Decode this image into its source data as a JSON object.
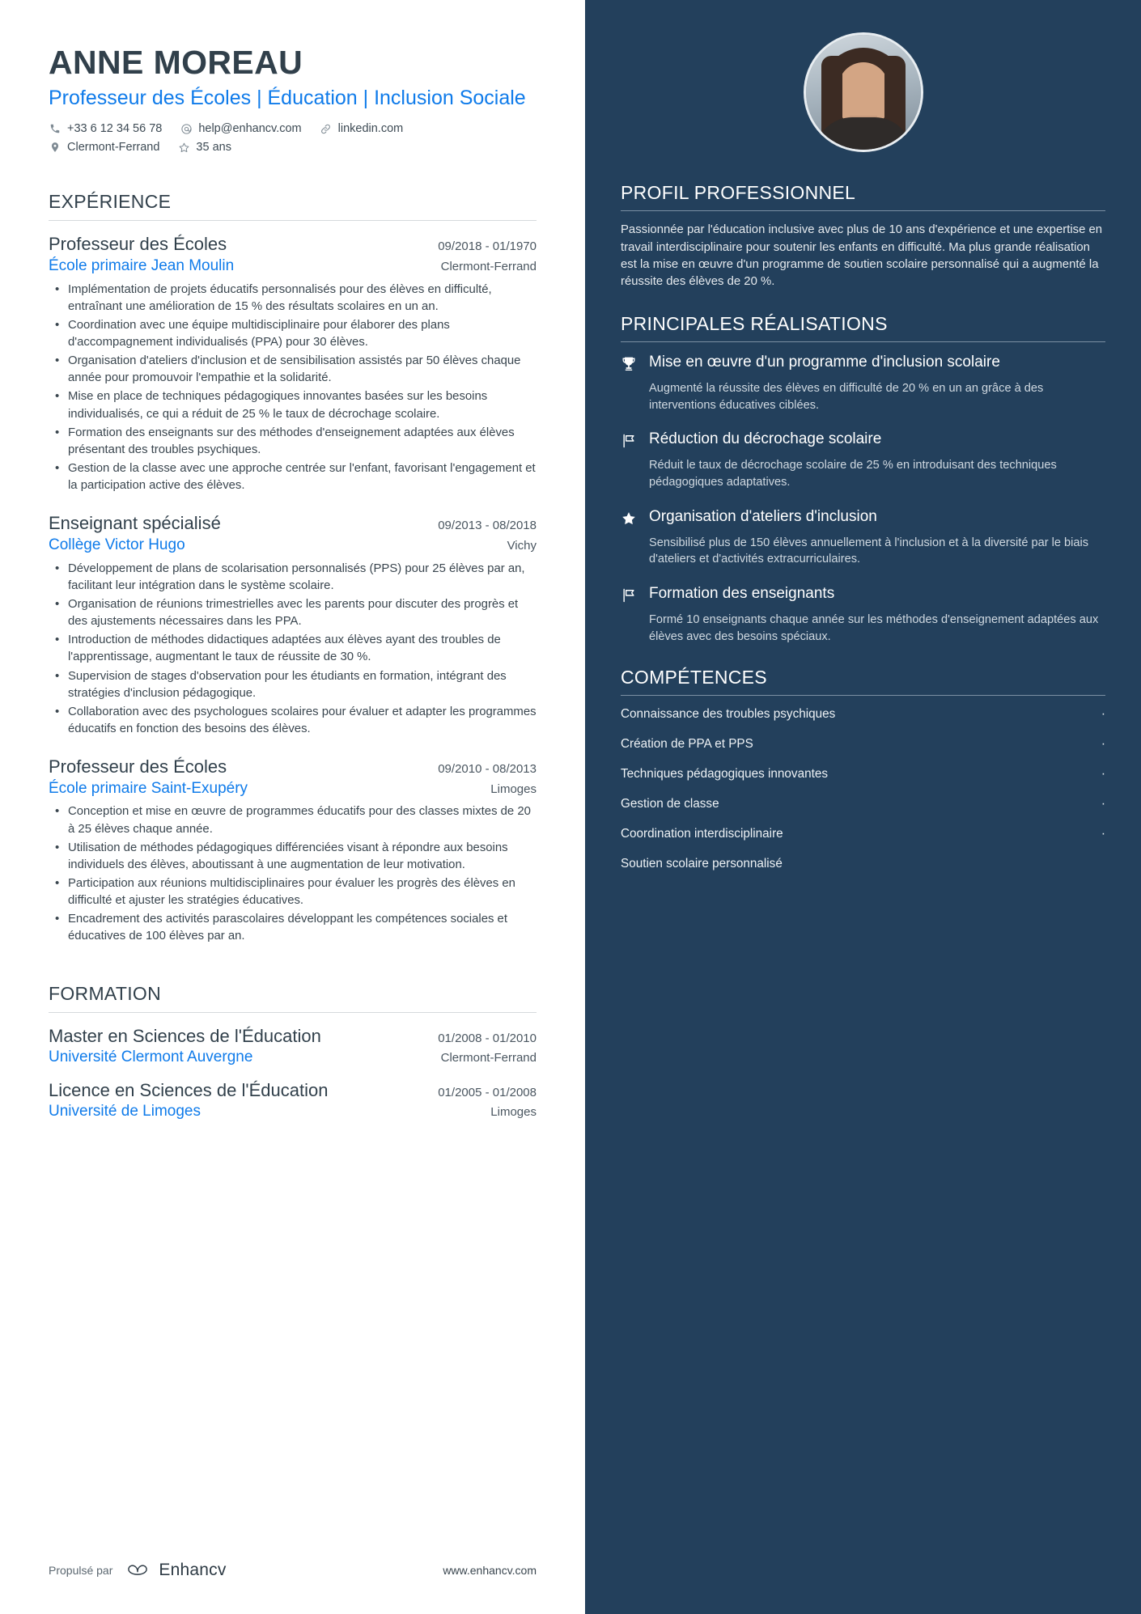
{
  "header": {
    "name": "ANNE MOREAU",
    "headline": "Professeur des Écoles | Éducation | Inclusion Sociale",
    "contact": {
      "phone": "+33 6 12 34 56 78",
      "email": "help@enhancv.com",
      "link": "linkedin.com",
      "location": "Clermont-Ferrand",
      "age": "35 ans"
    }
  },
  "sections": {
    "experience_title": "EXPÉRIENCE",
    "education_title": "FORMATION"
  },
  "experience": [
    {
      "title": "Professeur des Écoles",
      "date": "09/2018 - 01/1970",
      "org": "École primaire Jean Moulin",
      "location": "Clermont-Ferrand",
      "bullets": [
        "Implémentation de projets éducatifs personnalisés pour des élèves en difficulté, entraînant une amélioration de 15 % des résultats scolaires en un an.",
        "Coordination avec une équipe multidisciplinaire pour élaborer des plans d'accompagnement individualisés (PPA) pour 30 élèves.",
        "Organisation d'ateliers d'inclusion et de sensibilisation assistés par 50 élèves chaque année pour promouvoir l'empathie et la solidarité.",
        "Mise en place de techniques pédagogiques innovantes basées sur les besoins individualisés, ce qui a réduit de 25 % le taux de décrochage scolaire.",
        "Formation des enseignants sur des méthodes d'enseignement adaptées aux élèves présentant des troubles psychiques.",
        "Gestion de la classe avec une approche centrée sur l'enfant, favorisant l'engagement et la participation active des élèves."
      ]
    },
    {
      "title": "Enseignant spécialisé",
      "date": "09/2013 - 08/2018",
      "org": "Collège Victor Hugo",
      "location": "Vichy",
      "bullets": [
        "Développement de plans de scolarisation personnalisés (PPS) pour 25 élèves par an, facilitant leur intégration dans le système scolaire.",
        "Organisation de réunions trimestrielles avec les parents pour discuter des progrès et des ajustements nécessaires dans les PPA.",
        "Introduction de méthodes didactiques adaptées aux élèves ayant des troubles de l'apprentissage, augmentant le taux de réussite de 30 %.",
        "Supervision de stages d'observation pour les étudiants en formation, intégrant des stratégies d'inclusion pédagogique.",
        "Collaboration avec des psychologues scolaires pour évaluer et adapter les programmes éducatifs en fonction des besoins des élèves."
      ]
    },
    {
      "title": "Professeur des Écoles",
      "date": "09/2010 - 08/2013",
      "org": "École primaire Saint-Exupéry",
      "location": "Limoges",
      "bullets": [
        "Conception et mise en œuvre de programmes éducatifs pour des classes mixtes de 20 à 25 élèves chaque année.",
        "Utilisation de méthodes pédagogiques différenciées visant à répondre aux besoins individuels des élèves, aboutissant à une augmentation de leur motivation.",
        "Participation aux réunions multidisciplinaires pour évaluer les progrès des élèves en difficulté et ajuster les stratégies éducatives.",
        "Encadrement des activités parascolaires développant les compétences sociales et éducatives de 100 élèves par an."
      ]
    }
  ],
  "education": [
    {
      "title": "Master en Sciences de l'Éducation",
      "date": "01/2008 - 01/2010",
      "org": "Université Clermont Auvergne",
      "location": "Clermont-Ferrand"
    },
    {
      "title": "Licence en Sciences de l'Éducation",
      "date": "01/2005 - 01/2008",
      "org": "Université de Limoges",
      "location": "Limoges"
    }
  ],
  "sidebar": {
    "profile_title": "PROFIL PROFESSIONNEL",
    "profile_text": "Passionnée par l'éducation inclusive avec plus de 10 ans d'expérience et une expertise en travail interdisciplinaire pour soutenir les enfants en difficulté. Ma plus grande réalisation est la mise en œuvre d'un programme de soutien scolaire personnalisé qui a augmenté la réussite des élèves de 20 %.",
    "achievements_title": "PRINCIPALES RÉALISATIONS",
    "achievements": [
      {
        "icon": "trophy-icon",
        "title": "Mise en œuvre d'un programme d'inclusion scolaire",
        "desc": "Augmenté la réussite des élèves en difficulté de 20 % en un an grâce à des interventions éducatives ciblées."
      },
      {
        "icon": "flag-icon",
        "title": "Réduction du décrochage scolaire",
        "desc": "Réduit le taux de décrochage scolaire de 25 % en introduisant des techniques pédagogiques adaptatives."
      },
      {
        "icon": "star-icon",
        "title": "Organisation d'ateliers d'inclusion",
        "desc": "Sensibilisé plus de 150 élèves annuellement à l'inclusion et à la diversité par le biais d'ateliers et d'activités extracurriculaires."
      },
      {
        "icon": "flag-icon",
        "title": "Formation des enseignants",
        "desc": "Formé 10 enseignants chaque année sur les méthodes d'enseignement adaptées aux élèves avec des besoins spéciaux."
      }
    ],
    "skills_title": "COMPÉTENCES",
    "skills": [
      "Connaissance des troubles psychiques",
      "Création de PPA et PPS",
      "Techniques pédagogiques innovantes",
      "Gestion de classe",
      "Coordination interdisciplinaire",
      "Soutien scolaire personnalisé"
    ],
    "skill_separator": "·"
  },
  "footer": {
    "powered_by": "Propulsé par",
    "brand": "Enhancv",
    "url": "www.enhancv.com"
  },
  "colors": {
    "accent_blue": "#0f7bea",
    "sidebar_navy": "#23405c",
    "heading_dark": "#31404b"
  }
}
